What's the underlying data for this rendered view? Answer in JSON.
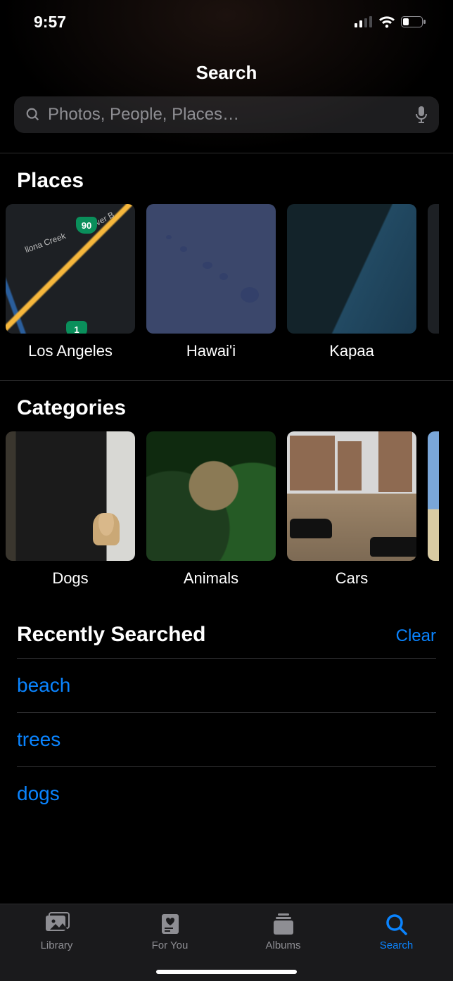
{
  "status": {
    "time": "9:57"
  },
  "page_title": "Search",
  "search": {
    "placeholder": "Photos, People, Places…"
  },
  "places": {
    "title": "Places",
    "items": [
      {
        "label": "Los Angeles"
      },
      {
        "label": "Hawai'i"
      },
      {
        "label": "Kapaa"
      }
    ],
    "la_shield_1": "90",
    "la_shield_2": "1",
    "la_road_1": "Culver B",
    "la_road_2": "llona Creek"
  },
  "categories": {
    "title": "Categories",
    "items": [
      {
        "label": "Dogs"
      },
      {
        "label": "Animals"
      },
      {
        "label": "Cars"
      }
    ]
  },
  "recent": {
    "title": "Recently Searched",
    "clear": "Clear",
    "items": [
      {
        "term": "beach"
      },
      {
        "term": "trees"
      },
      {
        "term": "dogs"
      }
    ]
  },
  "tabs": {
    "library": "Library",
    "for_you": "For You",
    "albums": "Albums",
    "search": "Search"
  }
}
